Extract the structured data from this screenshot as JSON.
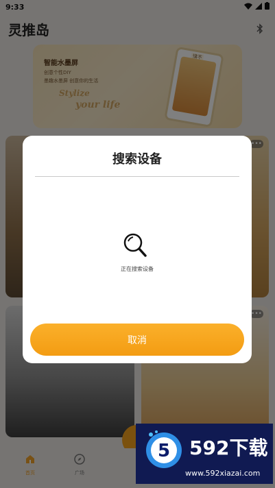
{
  "status_bar": {
    "time": "9:33"
  },
  "header": {
    "title": "灵推岛"
  },
  "banner": {
    "title": "智能水墨屏",
    "line1": "创意个性DIY",
    "line2": "墨趣水墨屏 创意你的生活",
    "script1": "Stylize",
    "script2": "your life",
    "card_tag": "惜不"
  },
  "cards": {
    "more_label": "•••"
  },
  "bottom_nav": {
    "items": [
      {
        "label": "首页"
      },
      {
        "label": "广场"
      }
    ]
  },
  "dialog": {
    "title": "搜索设备",
    "status": "正在搜索设备",
    "cancel_label": "取消"
  },
  "watermark": {
    "brand": "592下载",
    "url": "www.592xiazai.com",
    "logo_text": "5"
  },
  "colors": {
    "accent": "#f7a31c",
    "watermark_bg": "#101a52"
  }
}
